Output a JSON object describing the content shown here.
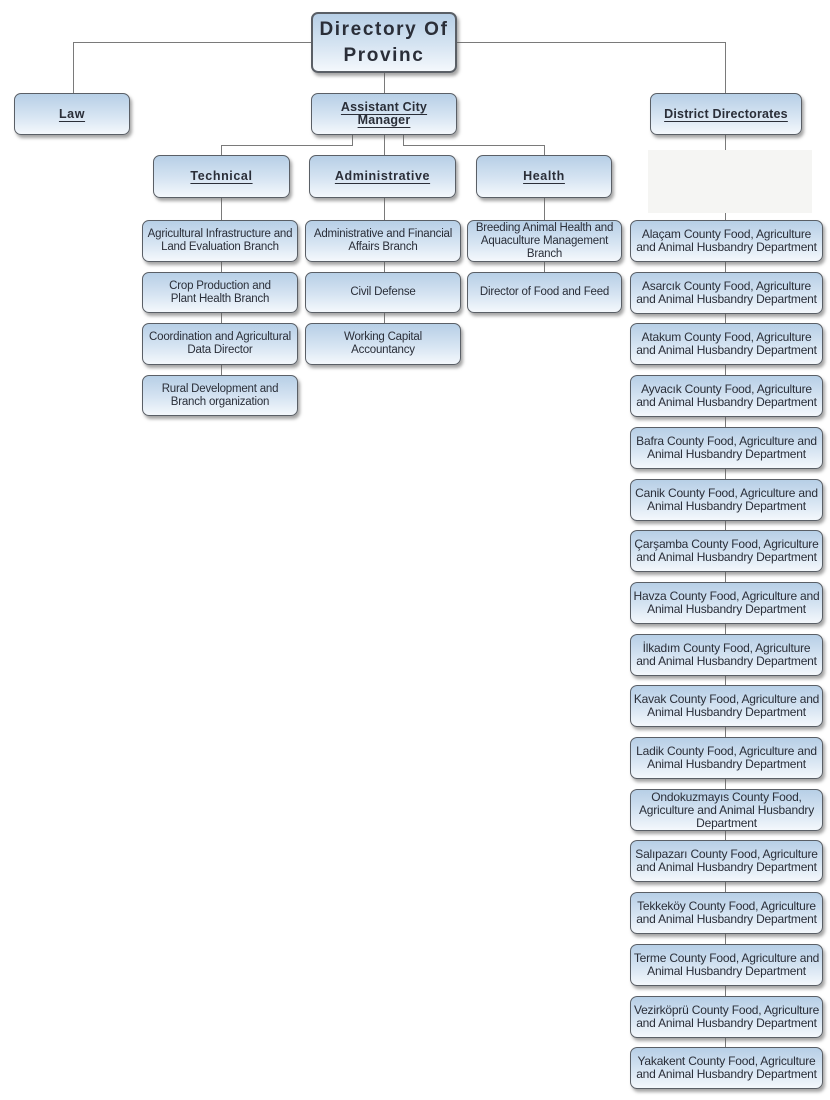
{
  "root": {
    "label": "Directory Of\nProvinc"
  },
  "level1": {
    "law": "Law",
    "assistant": "Assistant City Manager",
    "district": "District Directorates"
  },
  "departments": {
    "technical": {
      "label": "Technical",
      "children": [
        "Agricultural Infrastructure and Land Evaluation Branch",
        "Crop Production and Plant Health Branch",
        "Coordination and Agricultural Data Director",
        "Rural Development and Branch organization"
      ]
    },
    "administrative": {
      "label": "Administrative",
      "children": [
        "Administrative and Financial Affairs Branch",
        "Civil Defense",
        "Working Capital Accountancy"
      ]
    },
    "health": {
      "label": "Health",
      "children": [
        "Breeding Animal Health and Aquaculture Management Branch",
        "Director of Food and Feed"
      ]
    }
  },
  "districts": [
    "Alaçam County Food, Agriculture and Animal Husbandry Department",
    "Asarcık County Food, Agriculture and Animal Husbandry Department",
    "Atakum County Food, Agriculture and Animal Husbandry Department",
    "Ayvacık County Food, Agriculture and Animal Husbandry Department",
    "Bafra County Food, Agriculture and Animal Husbandry Department",
    "Canik County Food, Agriculture and Animal Husbandry Department",
    "Çarşamba County Food, Agriculture and Animal Husbandry Department",
    "Havza County Food, Agriculture and Animal Husbandry Department",
    "İlkadım County Food, Agriculture and Animal Husbandry Department",
    "Kavak County Food, Agriculture and Animal Husbandry Department",
    "Ladik County Food, Agriculture and Animal Husbandry Department",
    "Ondokuzmayıs County Food, Agriculture and Animal Husbandry Department",
    "Salıpazarı County Food, Agriculture and Animal Husbandry Department",
    "Tekkeköy County Food, Agriculture and Animal Husbandry Department",
    "Terme County Food, Agriculture and Animal Husbandry Department",
    "Vezirköprü County Food, Agriculture and Animal Husbandry Department",
    "Yakakent County Food, Agriculture and Animal Husbandry Department"
  ],
  "colors": {
    "box_top": "#b7cfe6",
    "box_bottom": "#f4f8fc",
    "border": "#5a5f66",
    "line": "#7a7a7a",
    "text": "#2a2e38"
  }
}
